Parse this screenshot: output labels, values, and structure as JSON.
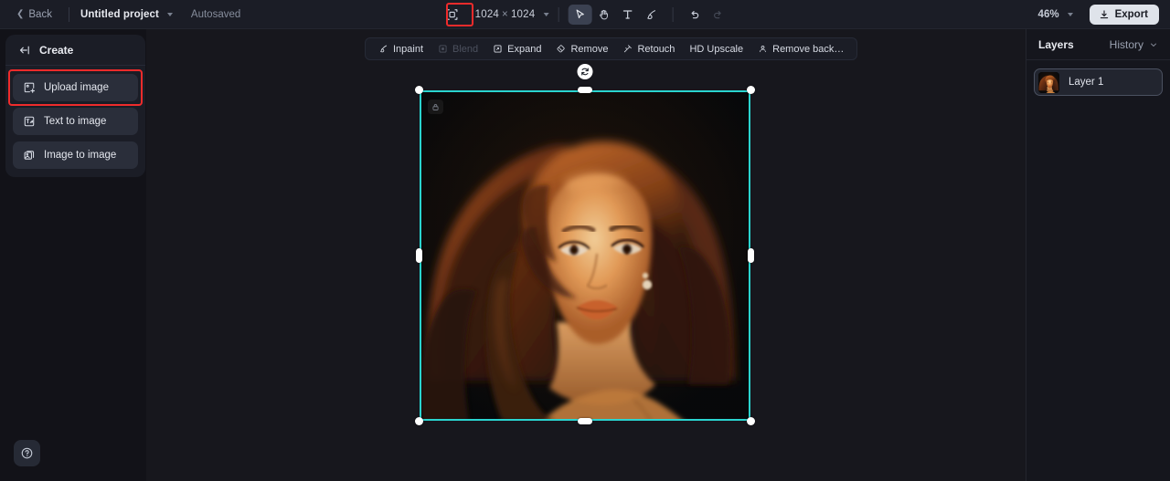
{
  "header": {
    "back_label": "Back",
    "project_name": "Untitled project",
    "autosave_status": "Autosaved",
    "canvas_size": {
      "width": "1024",
      "height": "1024",
      "separator": "×"
    },
    "zoom_level": "46%",
    "export_label": "Export",
    "tools": [
      {
        "name": "crop-frame-tool",
        "icon": "crop-frame-icon",
        "active": false,
        "highlighted": true
      },
      {
        "name": "select-tool",
        "icon": "cursor-arrow-icon",
        "active": true
      },
      {
        "name": "pan-tool",
        "icon": "hand-icon",
        "active": false
      },
      {
        "name": "text-tool",
        "icon": "text-t-icon",
        "active": false
      },
      {
        "name": "brush-tool",
        "icon": "brush-icon",
        "active": false
      },
      {
        "name": "undo",
        "icon": "undo-arrow-icon",
        "active": false
      },
      {
        "name": "redo",
        "icon": "redo-arrow-icon",
        "active": false,
        "disabled": true
      }
    ]
  },
  "sidebar": {
    "title": "Create",
    "collapse_icon": "collapse-panel-icon",
    "items": [
      {
        "label": "Upload image",
        "icon": "upload-image-icon",
        "highlighted": true
      },
      {
        "label": "Text to image",
        "icon": "text-to-image-icon",
        "highlighted": false
      },
      {
        "label": "Image to image",
        "icon": "image-to-image-icon",
        "highlighted": false
      }
    ],
    "help_icon": "help-question-icon"
  },
  "canvas_toolbar": {
    "items": [
      {
        "label": "Inpaint",
        "icon": "inpaint-brush-icon",
        "disabled": false
      },
      {
        "label": "Blend",
        "icon": "blend-square-icon",
        "disabled": true
      },
      {
        "label": "Expand",
        "icon": "expand-frame-icon",
        "disabled": false
      },
      {
        "label": "Remove",
        "icon": "eraser-icon",
        "disabled": false
      },
      {
        "label": "Retouch",
        "icon": "retouch-wand-icon",
        "disabled": false
      },
      {
        "label": "HD Upscale",
        "icon": "hd-upscale-icon",
        "disabled": false
      },
      {
        "label": "Remove back…",
        "icon": "remove-background-icon",
        "disabled": false
      }
    ]
  },
  "canvas": {
    "selection": {
      "rotate_icon": "rotate-handle-icon",
      "badge_icon": "image-lock-badge-icon",
      "border_color": "#2ad4cf",
      "handle_color": "#ffffff"
    },
    "background_color": "#17171d"
  },
  "right_panel": {
    "tab_layers": "Layers",
    "tab_history": "History",
    "history_chevron_icon": "chevron-down-icon",
    "layers": [
      {
        "name": "Layer 1",
        "thumbnail": "portrait-thumbnail"
      }
    ]
  },
  "colors": {
    "accent_selection": "#2ad4cf",
    "highlight_box": "#ef2b2b",
    "header_bg": "#1b1d26",
    "panel_bg": "#1b1d26",
    "canvas_bg": "#17171d",
    "export_bg": "#dfe3ea"
  }
}
